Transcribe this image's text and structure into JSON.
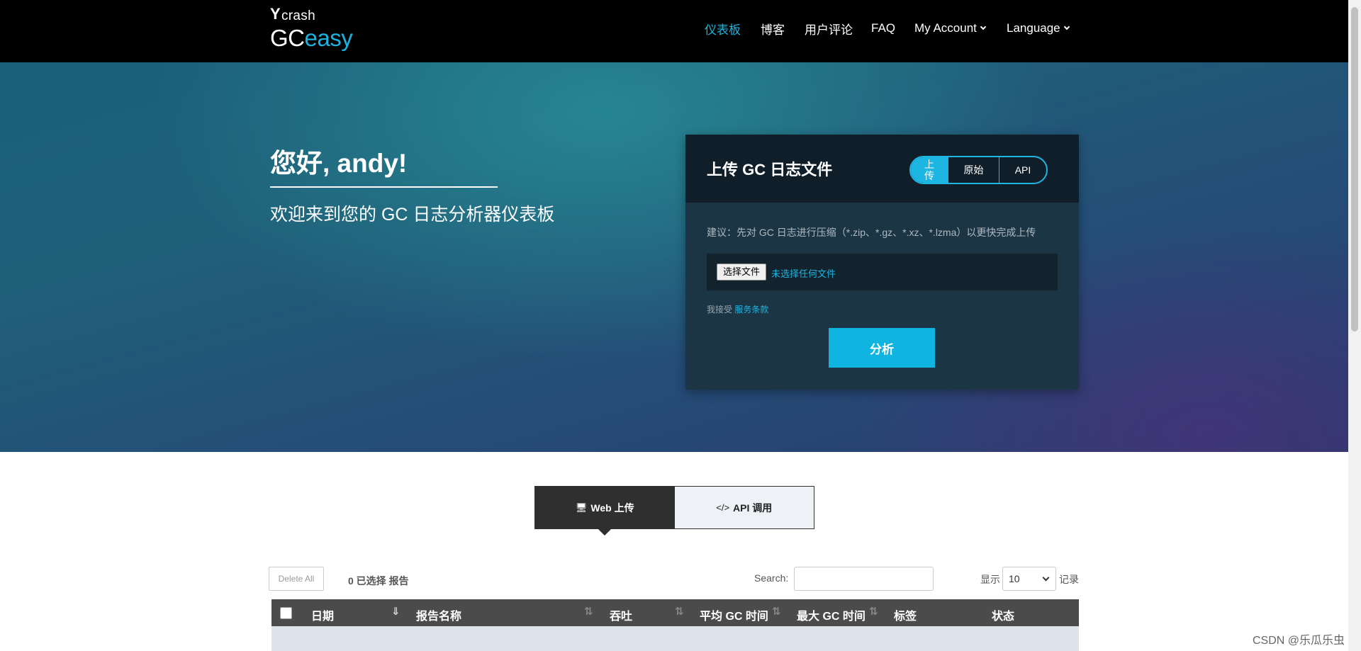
{
  "header": {
    "logo_top": "crash",
    "logo_main": "GC",
    "logo_accent": "easy",
    "nav": {
      "dashboard": "仪表板",
      "blog": "博客",
      "reviews": "用户评论",
      "faq": "FAQ",
      "account": "My Account",
      "language": "Language"
    },
    "active_color": "#1db5e2"
  },
  "hero": {
    "greeting": "您好, andy!",
    "subtitle": "欢迎来到您的 GC 日志分析器仪表板"
  },
  "upload": {
    "title": "上传 GC 日志文件",
    "tabs": [
      "上传",
      "原始",
      "API"
    ],
    "tip": "建议：先对 GC 日志进行压缩（*.zip、*.gz、*.xz、*.lzma）以更快完成上传",
    "choose_file": "选择文件",
    "no_file": "未选择任何文件",
    "terms_prefix": "我接受",
    "terms_link": "服务条款",
    "analyze": "分析"
  },
  "reports": {
    "mode_tabs": [
      "Web 上传",
      "API 调用"
    ],
    "delete_all": "Delete All",
    "selected": "0 已选择 报告",
    "search_label": "Search:",
    "search_value": "",
    "show_label": "显示",
    "page_size": "10",
    "records_label": "记录",
    "columns": [
      "日期",
      "报告名称",
      "吞吐",
      "平均 GC 时间",
      "最大 GC 时间",
      "标签",
      "状态"
    ]
  },
  "watermark": "CSDN @乐瓜乐虫"
}
